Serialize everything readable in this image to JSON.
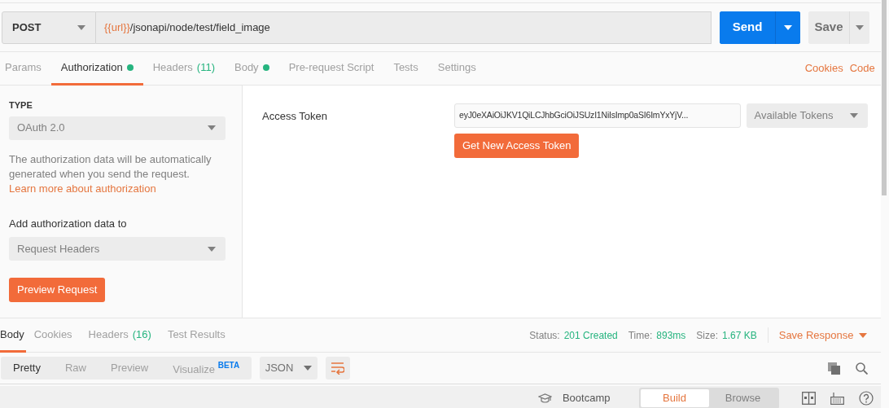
{
  "request": {
    "method": "POST",
    "url_variable": "{{url}}",
    "url_path": "/jsonapi/node/test/field_image",
    "send_button": "Send",
    "save_button": "Save"
  },
  "tabs": [
    {
      "label": "Params",
      "selected": false,
      "dot": false
    },
    {
      "label": "Authorization",
      "selected": true,
      "dot": true
    },
    {
      "label": "Headers",
      "count": "(11)",
      "selected": false,
      "dot": false
    },
    {
      "label": "Body",
      "selected": false,
      "dot": true
    },
    {
      "label": "Pre-request Script",
      "selected": false,
      "dot": false
    },
    {
      "label": "Tests",
      "selected": false,
      "dot": false
    },
    {
      "label": "Settings",
      "selected": false,
      "dot": false
    }
  ],
  "tab_links": [
    "Cookies",
    "Code"
  ],
  "auth": {
    "type_label": "TYPE",
    "type": "OAuth 2.0",
    "description": "The authorization data will be automatically generated when you send the request.",
    "learn_link": "Learn more about authorization",
    "add_to_label": "Add authorization data to",
    "add_to": "Request Headers",
    "preview_button": "Preview Request",
    "token_label": "Access Token",
    "token": "eyJ0eXAiOiJKV1QiLCJhbGciOiJSUzI1NiIsImp0aSI6ImYxYjV...",
    "tokens_dropdown": "Available Tokens",
    "get_token_button": "Get New Access Token"
  },
  "response": {
    "tabs": [
      {
        "label": "Body",
        "selected": true
      },
      {
        "label": "Cookies",
        "selected": false
      },
      {
        "label": "Headers",
        "count": "(16)",
        "selected": false
      },
      {
        "label": "Test Results",
        "selected": false
      }
    ],
    "status_label": "Status:",
    "status": "201 Created",
    "time_label": "Time:",
    "time": "893ms",
    "size_label": "Size:",
    "size": "1.67 KB",
    "save_response": "Save Response",
    "views": [
      {
        "label": "Pretty",
        "selected": true
      },
      {
        "label": "Raw",
        "selected": false
      },
      {
        "label": "Preview",
        "selected": false
      },
      {
        "label": "Visualize",
        "badge": "BETA",
        "selected": false
      }
    ],
    "format": "JSON"
  },
  "footer": {
    "bootcamp": "Bootcamp",
    "modes": [
      {
        "label": "Build",
        "selected": true
      },
      {
        "label": "Browse",
        "selected": false
      }
    ]
  }
}
